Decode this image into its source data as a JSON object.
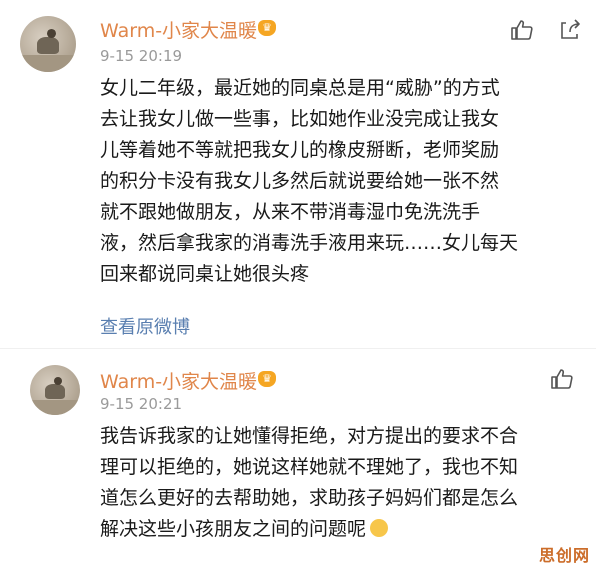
{
  "post": {
    "username": "Warm-小家大温暖",
    "time": "9-15 20:19",
    "lines": [
      "女儿二年级，最近她的同桌总是用“威胁”的方式",
      "去让我女儿做一些事，比如她作业没完成让我女",
      "儿等着她不等就把我女儿的橡皮掰断，老师奖励",
      "的积分卡没有我女儿多然后就说要给她一张不然",
      "就不跟她做朋友，从来不带消毒湿巾免洗洗手",
      "液，然后拿我家的消毒洗手液用来玩……女儿每天",
      "回来都说同桌让她很头疼"
    ],
    "view_original": "查看原微博"
  },
  "reply": {
    "username": "Warm-小家大温暖",
    "time": "9-15 20:21",
    "lines": [
      "我告诉我家的让她懂得拒绝，对方提出的要求不合",
      "理可以拒绝的，她说这样她就不理她了，我也不知",
      "道怎么更好的去帮助她，求助孩子妈妈们都是怎么",
      "解决这些小孩朋友之间的问题呢"
    ]
  },
  "watermark": "思创网",
  "icons": {
    "badge": "crown-badge-icon",
    "like": "thumb-up-icon",
    "share": "share-icon",
    "emoji": "laughing-emoji-icon"
  },
  "colors": {
    "username": "#e0864a",
    "link": "#5a7fb0",
    "time": "#9a9a9a"
  }
}
